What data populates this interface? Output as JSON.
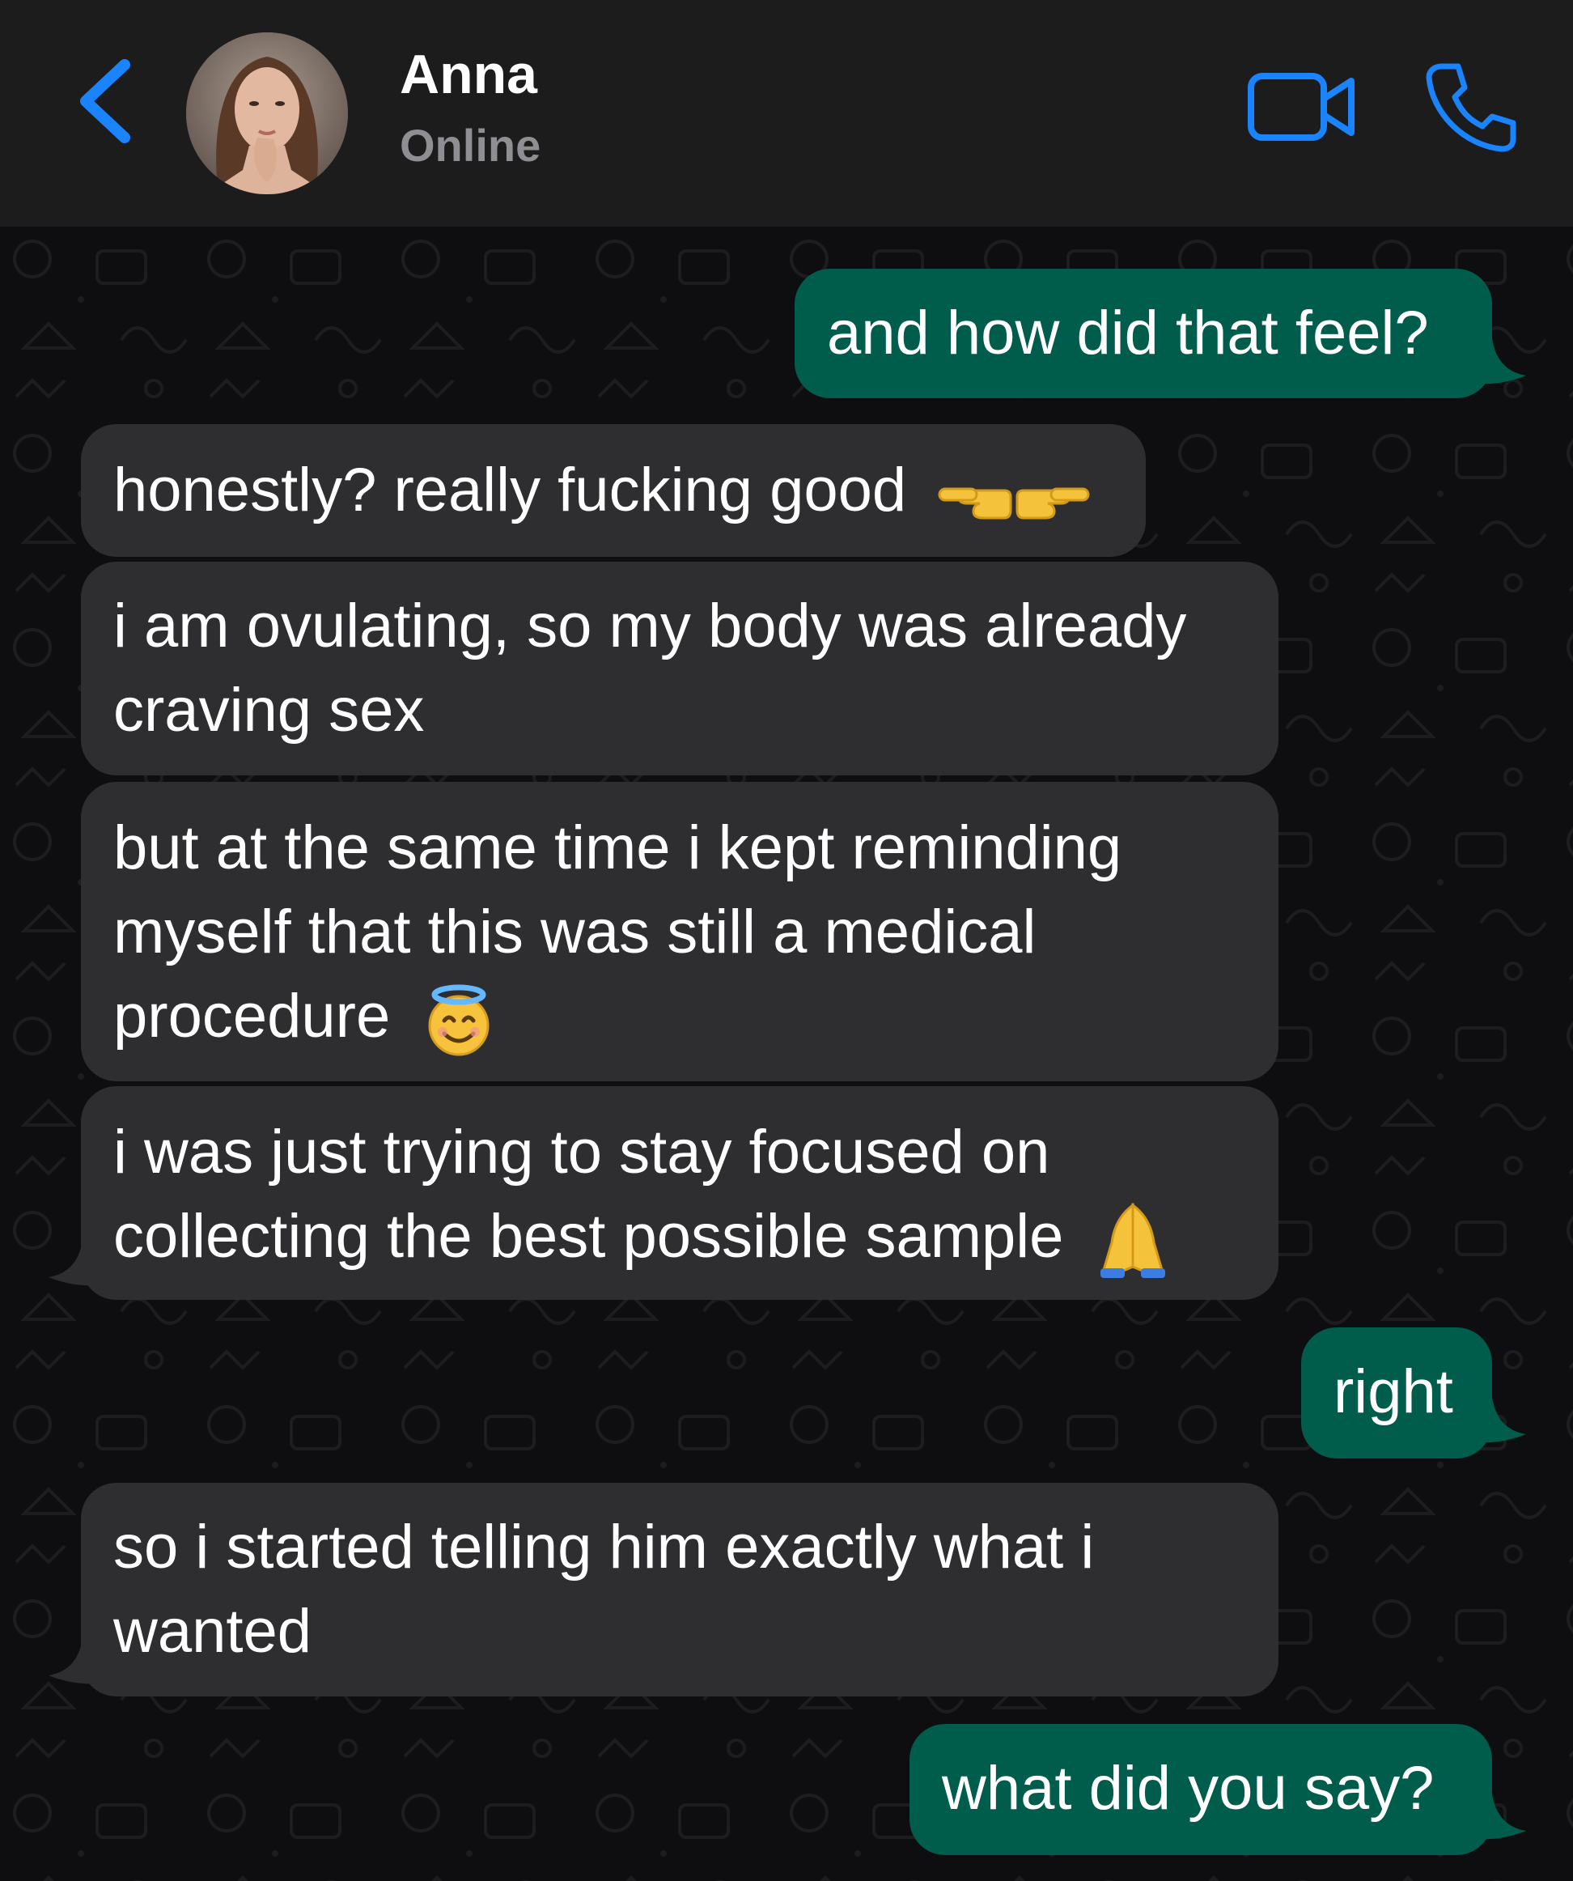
{
  "header": {
    "contact_name": "Anna",
    "status": "Online",
    "back_icon": "chevron-left-icon",
    "video_icon": "video-call-icon",
    "phone_icon": "phone-call-icon"
  },
  "colors": {
    "header_bg": "#1c1c1d",
    "chat_bg": "#0e0e10",
    "incoming_bubble": "#2e2e30",
    "outgoing_bubble": "#005c4b",
    "accent_blue": "#1a84ff",
    "status_gray": "#8e8e93"
  },
  "messages": [
    {
      "direction": "outgoing",
      "text": "and how did that feel?"
    },
    {
      "direction": "incoming",
      "text": "honestly? really fucking good",
      "emoji": "pointing-hands"
    },
    {
      "direction": "incoming",
      "line1": "i am ovulating, so my body was already",
      "line2": "craving sex"
    },
    {
      "direction": "incoming",
      "line1": "but at the same time i kept reminding",
      "line2": "myself that this was still a medical",
      "line3": "procedure",
      "emoji": "smiling-face-with-halo"
    },
    {
      "direction": "incoming",
      "line1": "i was just trying to stay focused on",
      "line2": "collecting the best possible sample",
      "emoji": "folded-hands"
    },
    {
      "direction": "outgoing",
      "text": "right"
    },
    {
      "direction": "incoming",
      "line1": "so i started telling him exactly what i",
      "line2": "wanted"
    },
    {
      "direction": "outgoing",
      "text": "what did you say?"
    }
  ]
}
